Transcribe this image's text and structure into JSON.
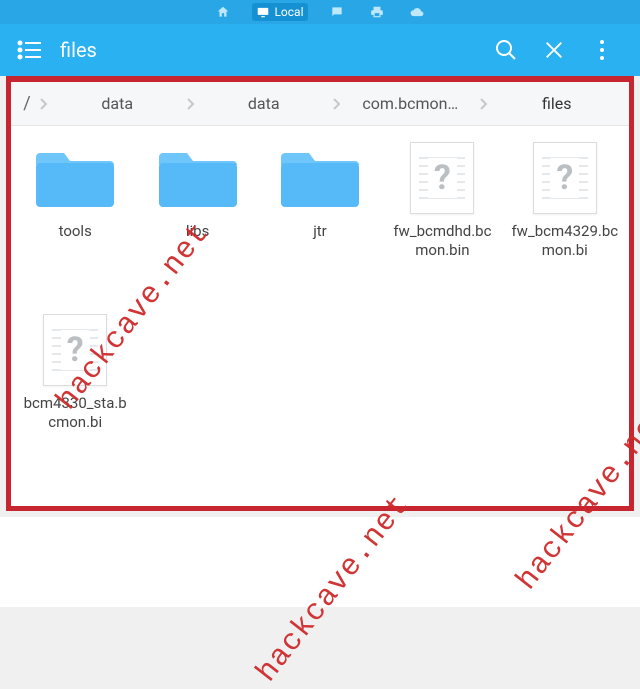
{
  "statusbar": {
    "tab_label": "Local"
  },
  "appbar": {
    "title": "files"
  },
  "breadcrumb": {
    "root": "/",
    "segments": [
      "data",
      "data",
      "com.bcmon…",
      "files"
    ]
  },
  "items": [
    {
      "name": "tools",
      "type": "folder"
    },
    {
      "name": "libs",
      "type": "folder"
    },
    {
      "name": "jtr",
      "type": "folder"
    },
    {
      "name": "fw_bcmdhd.bcmon.bin",
      "type": "file"
    },
    {
      "name": "fw_bcm4329.bcmon.bi",
      "type": "file"
    },
    {
      "name": "bcm4330_sta.bcmon.bi",
      "type": "file"
    }
  ],
  "watermark": "hackcave.net"
}
